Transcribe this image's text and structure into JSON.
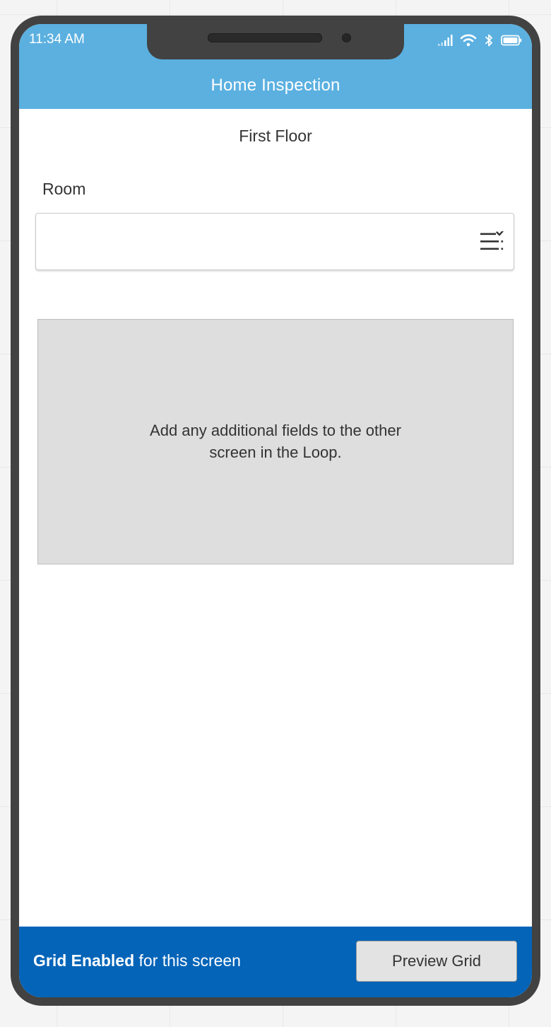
{
  "status_bar": {
    "time": "11:34 AM",
    "icons": [
      "signal-icon",
      "wifi-icon",
      "bluetooth-icon",
      "battery-icon"
    ]
  },
  "header": {
    "title": "Home Inspection"
  },
  "screen": {
    "section_title": "First Floor",
    "room_field": {
      "label": "Room",
      "value": "",
      "icon": "list-select-icon"
    },
    "placeholder_message": "Add any additional fields to the other screen in the Loop."
  },
  "footer": {
    "status_bold": "Grid Enabled",
    "status_rest": " for this screen",
    "preview_button_label": "Preview Grid"
  },
  "colors": {
    "header_bg": "#5bb0e0",
    "footer_bg": "#0364b8",
    "placeholder_bg": "#dedede",
    "device_frame": "#424242"
  }
}
